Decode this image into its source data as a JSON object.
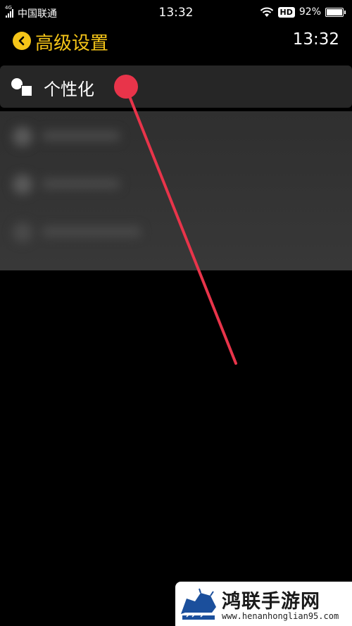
{
  "status_bar": {
    "network_type": "4G",
    "carrier": "中国联通",
    "time": "13:32",
    "hd_badge": "HD",
    "battery_percent": "92%",
    "battery_level": 0.92
  },
  "header": {
    "title": "高级设置",
    "time": "13:32",
    "accent_color": "#f5c518"
  },
  "settings": {
    "personalization_label": "个性化"
  },
  "annotation": {
    "pointer_color": "#e8344a"
  },
  "watermark": {
    "name": "鸿联手游网",
    "url": "www.henanhonglian95.com"
  }
}
